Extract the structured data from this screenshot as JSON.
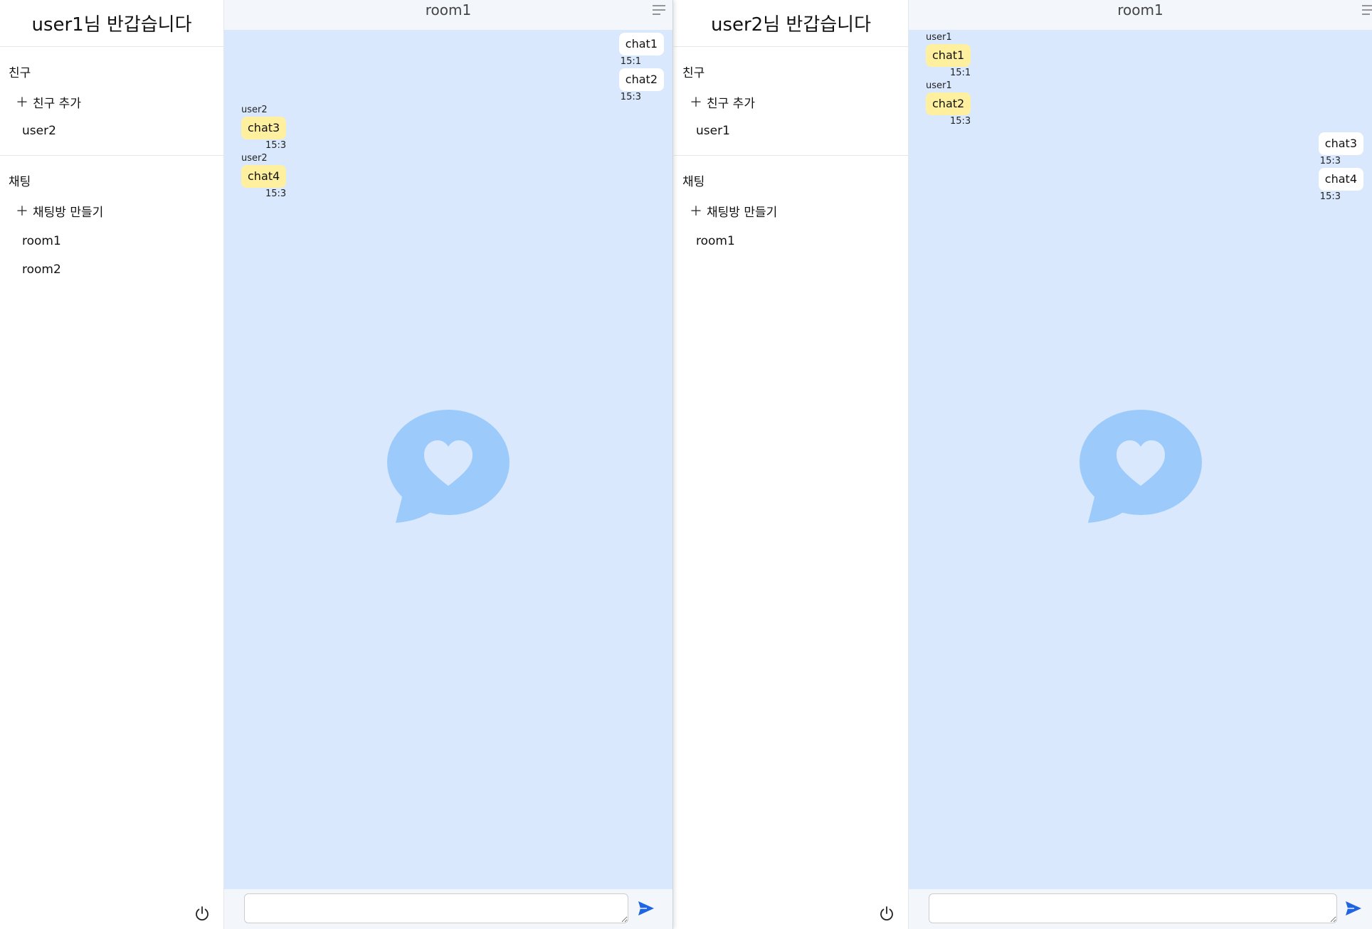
{
  "left": {
    "greeting": "user1님 반갑습니다",
    "friends_title": "친구",
    "add_friend": "친구 추가",
    "friends": [
      "user2"
    ],
    "chats_title": "채팅",
    "add_room": "채팅방 만들기",
    "rooms": [
      "room1",
      "room2"
    ],
    "room_title": "room1",
    "messages": [
      {
        "dir": "out",
        "text": "chat1",
        "time": "15:1"
      },
      {
        "dir": "out",
        "text": "chat2",
        "time": "15:3"
      },
      {
        "dir": "in",
        "sender": "user2",
        "text": "chat3",
        "time": "15:3"
      },
      {
        "dir": "in",
        "sender": "user2",
        "text": "chat4",
        "time": "15:3"
      }
    ]
  },
  "right": {
    "greeting": "user2님 반갑습니다",
    "friends_title": "친구",
    "add_friend": "친구 추가",
    "friends": [
      "user1"
    ],
    "chats_title": "채팅",
    "add_room": "채팅방 만들기",
    "rooms": [
      "room1"
    ],
    "room_title": "room1",
    "messages": [
      {
        "dir": "in",
        "sender": "user1",
        "text": "chat1",
        "time": "15:1"
      },
      {
        "dir": "in",
        "sender": "user1",
        "text": "chat2",
        "time": "15:3"
      },
      {
        "dir": "out",
        "text": "chat3",
        "time": "15:3"
      },
      {
        "dir": "out",
        "text": "chat4",
        "time": "15:3"
      }
    ]
  },
  "colors": {
    "chat_background": "#d9e8fd",
    "incoming_bubble": "#fff0a0",
    "outgoing_bubble": "#ffffff",
    "watermark": "#9ccbfb",
    "send_icon": "#1f64e0"
  },
  "icons": {
    "menu": "menu-icon",
    "power": "power-icon",
    "send": "send-icon",
    "plus": "plus-icon",
    "watermark": "chat-heart-icon"
  }
}
